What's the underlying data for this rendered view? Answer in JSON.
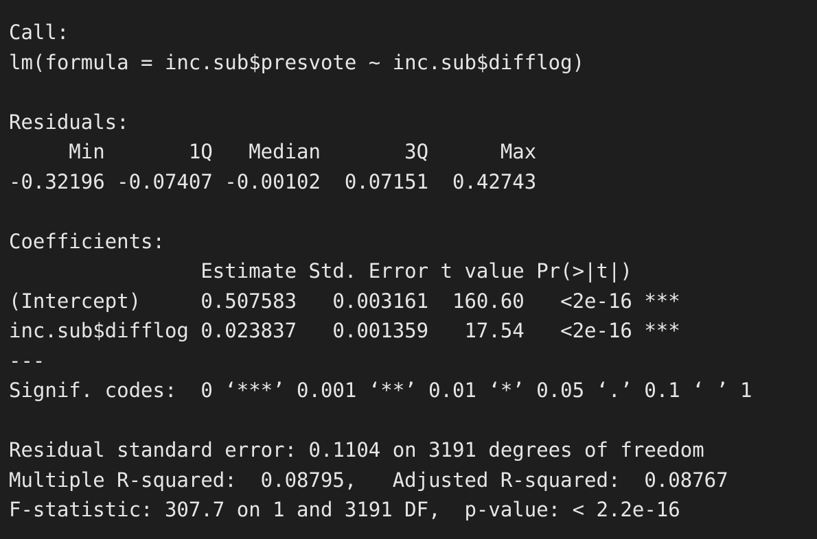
{
  "console": {
    "lines": [
      "Call:",
      "lm(formula = inc.sub$presvote ~ inc.sub$difflog)",
      "",
      "Residuals:",
      "     Min       1Q   Median       3Q      Max ",
      "-0.32196 -0.07407 -0.00102  0.07151  0.42743 ",
      "",
      "Coefficients:",
      "                Estimate Std. Error t value Pr(>|t|)    ",
      "(Intercept)     0.507583   0.003161  160.60   <2e-16 ***",
      "inc.sub$difflog 0.023837   0.001359   17.54   <2e-16 ***",
      "---",
      "Signif. codes:  0 ‘***’ 0.001 ‘**’ 0.01 ‘*’ 0.05 ‘.’ 0.1 ‘ ’ 1",
      "",
      "Residual standard error: 0.1104 on 3191 degrees of freedom",
      "Multiple R-squared:  0.08795,\tAdjusted R-squared:  0.08767 ",
      "F-statistic: 307.7 on 1 and 3191 DF,  p-value: < 2.2e-16"
    ]
  }
}
